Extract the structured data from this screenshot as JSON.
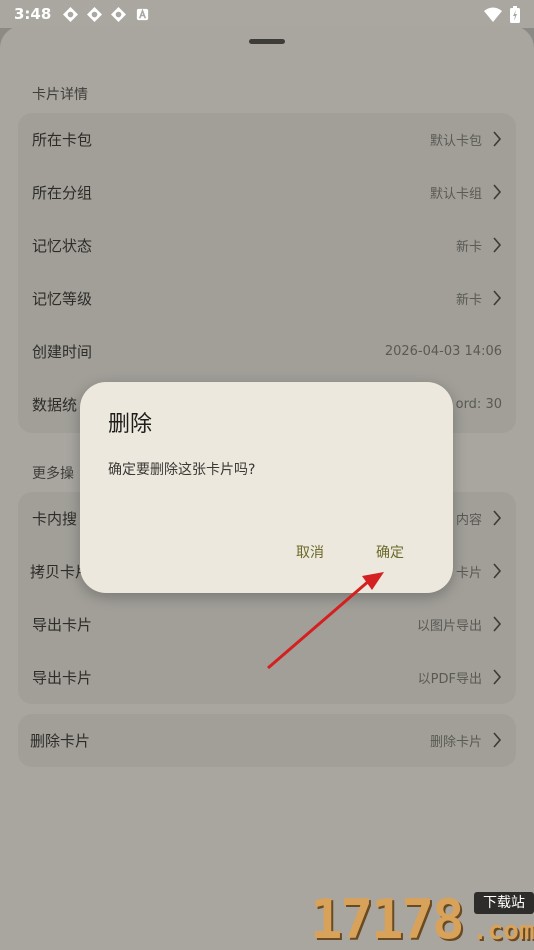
{
  "status_bar": {
    "time": "3:48",
    "icons": [
      "app-icon",
      "app-icon",
      "app-icon",
      "a-icon"
    ],
    "right_icons": [
      "wifi-icon",
      "battery-icon"
    ]
  },
  "sheet": {
    "section1_title": "卡片详情",
    "details": [
      {
        "label": "所在卡包",
        "value": "默认卡包",
        "arrow": true
      },
      {
        "label": "所在分组",
        "value": "默认卡组",
        "arrow": true
      },
      {
        "label": "记忆状态",
        "value": "新卡",
        "arrow": true
      },
      {
        "label": "记忆等级",
        "value": "新卡",
        "arrow": true
      },
      {
        "label": "创建时间",
        "value": "2026-04-03 14:06",
        "arrow": false
      },
      {
        "label": "数据统",
        "value": "ord: 30",
        "arrow": false
      }
    ],
    "section2_title": "更多操",
    "actions": [
      {
        "label": "卡内搜",
        "value": "内容",
        "arrow": true
      },
      {
        "label": "拷贝卡片",
        "value": "卡片",
        "arrow": true
      },
      {
        "label": "导出卡片",
        "value": "以图片导出",
        "arrow": true
      },
      {
        "label": "导出卡片",
        "value": "以PDF导出",
        "arrow": true
      }
    ],
    "delete": {
      "label": "删除卡片",
      "value": "删除卡片",
      "arrow": true
    }
  },
  "dialog": {
    "title": "删除",
    "message": "确定要删除这张卡片吗?",
    "cancel": "取消",
    "confirm": "确定"
  },
  "watermark": {
    "number": "17178",
    "tag": "下载站",
    "domain": ".com"
  },
  "colors": {
    "annotation_arrow": "#d42020",
    "dialog_button": "#6b6a2a"
  }
}
